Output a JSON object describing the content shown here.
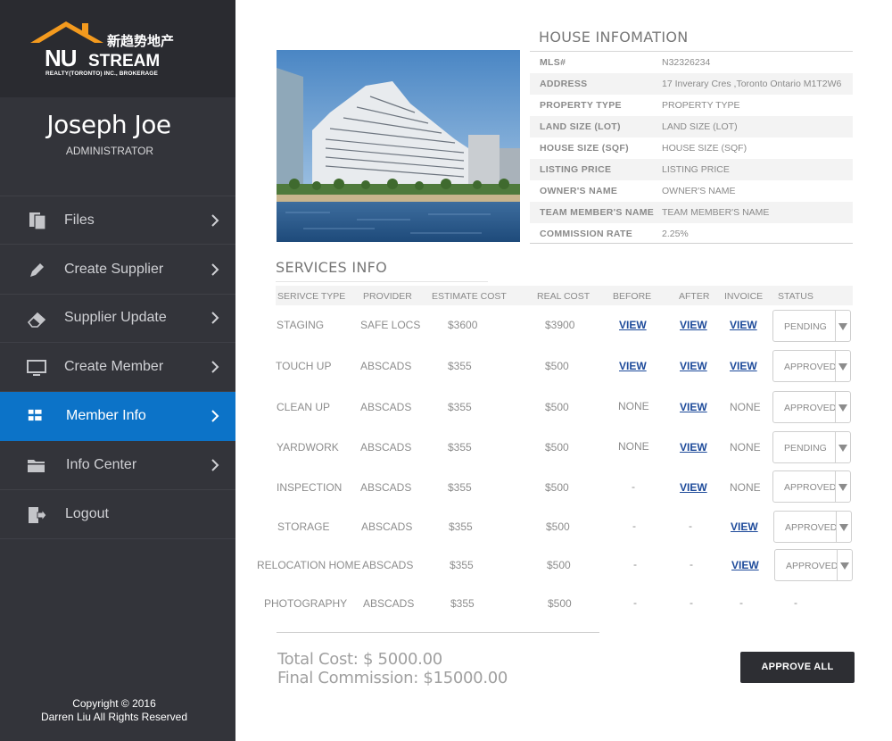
{
  "logo": {
    "chinese": "新趋势地产",
    "nu": "NU",
    "stream": "STREAM",
    "sub": "REALTY(TORONTO) INC., BROKERAGE"
  },
  "user": {
    "name": "Joseph Joe",
    "role": "ADMINISTRATOR"
  },
  "nav": [
    {
      "label": "Files",
      "icon": "file-icon"
    },
    {
      "label": "Create Supplier",
      "icon": "pencil-icon"
    },
    {
      "label": "Supplier Update",
      "icon": "eraser-icon"
    },
    {
      "label": "Create Member",
      "icon": "monitor-icon"
    },
    {
      "label": "Member Info",
      "icon": "grid-icon",
      "active": true
    },
    {
      "label": "Info Center",
      "icon": "folder-icon"
    },
    {
      "label": "Logout",
      "icon": "logout-icon"
    }
  ],
  "copyright": {
    "line1": "Copyright © 2016",
    "line2": "Darren Liu All Rights Reserved"
  },
  "house": {
    "title": "HOUSE INFOMATION",
    "rows": [
      {
        "key": "MLS#",
        "value": "N32326234"
      },
      {
        "key": "ADDRESS",
        "value": "17 Inverary Cres ,Toronto Ontario M1T2W6"
      },
      {
        "key": "PROPERTY TYPE",
        "value": "PROPERTY TYPE"
      },
      {
        "key": "LAND SIZE (LOT)",
        "value": "LAND SIZE (LOT)"
      },
      {
        "key": "HOUSE SIZE (SQF)",
        "value": "HOUSE SIZE (SQF)"
      },
      {
        "key": "LISTING PRICE",
        "value": "LISTING PRICE"
      },
      {
        "key": "OWNER'S NAME",
        "value": "OWNER'S NAME"
      },
      {
        "key": "TEAM MEMBER'S NAME",
        "value": "TEAM MEMBER'S NAME"
      },
      {
        "key": "COMMISSION RATE",
        "value": "2.25%"
      }
    ]
  },
  "services": {
    "title": "SERVICES INFO",
    "headers": [
      "SERIVCE TYPE",
      "PROVIDER",
      "ESTIMATE COST",
      "REAL COST",
      "BEFORE",
      "AFTER",
      "INVOICE",
      "STATUS"
    ],
    "rows": [
      {
        "type": "STAGING",
        "provider": "SAFE LOCS",
        "estimate": "$3600",
        "real": "$3900",
        "before": "VIEW",
        "after": "VIEW",
        "invoice": "VIEW",
        "status": "PENDING"
      },
      {
        "type": "TOUCH UP",
        "provider": "ABSCADS",
        "estimate": "$355",
        "real": "$500",
        "before": "VIEW",
        "after": "VIEW",
        "invoice": "VIEW",
        "status": "APPROVED"
      },
      {
        "type": "CLEAN UP",
        "provider": "ABSCADS",
        "estimate": "$355",
        "real": "$500",
        "before": "NONE",
        "after": "VIEW",
        "invoice": "NONE",
        "status": "APPROVED"
      },
      {
        "type": "YARDWORK",
        "provider": "ABSCADS",
        "estimate": "$355",
        "real": "$500",
        "before": "NONE",
        "after": "VIEW",
        "invoice": "NONE",
        "status": "PENDING"
      },
      {
        "type": "INSPECTION",
        "provider": "ABSCADS",
        "estimate": "$355",
        "real": "$500",
        "before": "-",
        "after": "VIEW",
        "invoice": "NONE",
        "status": "APPROVED"
      },
      {
        "type": "STORAGE",
        "provider": "ABSCADS",
        "estimate": "$355",
        "real": "$500",
        "before": "-",
        "after": "-",
        "invoice": "VIEW",
        "status": "APPROVED"
      },
      {
        "type": "RELOCATION HOME",
        "provider": "ABSCADS",
        "estimate": "$355",
        "real": "$500",
        "before": "-",
        "after": "-",
        "invoice": "VIEW",
        "status": "APPROVED"
      },
      {
        "type": "PHOTOGRAPHY",
        "provider": "ABSCADS",
        "estimate": "$355",
        "real": "$500",
        "before": "-",
        "after": "-",
        "invoice": "-",
        "status": "-"
      }
    ]
  },
  "totals": {
    "total_cost": "Total Cost:   $ 5000.00",
    "final_commission": "Final Commission: $15000.00"
  },
  "approve_all_label": "APPROVE ALL",
  "colors": {
    "sidebar": "#33343a",
    "logo_bg": "#2a2b30",
    "active": "#0c73c8",
    "link": "#1d4a9a",
    "roof": "#f39a1e"
  }
}
